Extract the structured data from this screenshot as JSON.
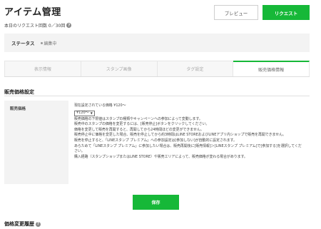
{
  "header": {
    "title": "アイテム管理",
    "request_count": "本日のリクエスト回数 0／30回"
  },
  "actions": {
    "preview_label": "プレビュー",
    "request_label": "リクエスト"
  },
  "status": {
    "label": "ステータス",
    "value": "編集中"
  },
  "tabs": [
    {
      "label": "表示情報",
      "active": false
    },
    {
      "label": "スタンプ画像",
      "active": false
    },
    {
      "label": "タグ設定",
      "active": false
    },
    {
      "label": "販売価格情報",
      "active": true
    }
  ],
  "price_settings": {
    "section_title": "販売価格設定",
    "row_label": "販売価格",
    "current_price": "現在設定されている価格 ¥120～",
    "selected_option": "¥120～",
    "notes": [
      "販売価格の下限値はスタンプの種類やキャンペーンへの参加によって変動します。",
      "販売中のスタンプの価格を変更するには、[販売停止]ボタンをクリックしてください。",
      "価格を変更して販売を再開すると、再開してから24時間ほどの変更ができません。",
      "販売停止中に価格を変更した場合、販売を停止してから約3時間はLINE STOREおよびLINEアプリ内ショップで販売を再開できません。",
      "販売を停止すると、「LINEスタンプ プレミアム」への参加設定は[参加しない]が自動的に設定されます。",
      "あらためて「LINEスタンプ プレミアム」に参加したい場合は、販売再開後に[販売情報]＞[LINEスタンプ プレミアム]で[参加する]を選択してください。",
      "購入経路（スタンプショップまたはLINE STORE）や販売エリアによって、販売価格が変わる場合があります。"
    ]
  },
  "save_label": "保存",
  "history": {
    "title": "価格変更履歴"
  },
  "colors": {
    "accent": "#16b838"
  },
  "icons": {
    "help": "question-circle-icon",
    "dropdown": "chevron-down-icon"
  }
}
